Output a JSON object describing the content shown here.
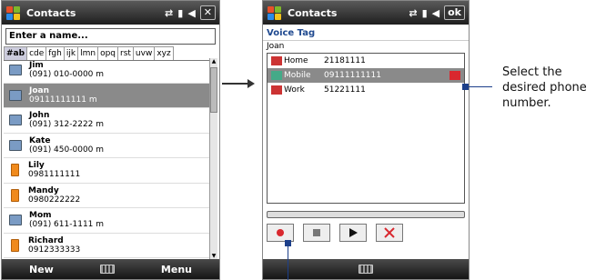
{
  "left": {
    "title": "Contacts",
    "close": "✕",
    "name_input": "Enter a name...",
    "tabs": [
      "#ab",
      "cde",
      "fgh",
      "ijk",
      "lmn",
      "opq",
      "rst",
      "uvw",
      "xyz"
    ],
    "contacts": [
      {
        "name": "Jim",
        "detail": "(091) 010-0000  m",
        "type": "card"
      },
      {
        "name": "Joan",
        "detail": "09111111111  m",
        "type": "card",
        "selected": true
      },
      {
        "name": "John",
        "detail": "(091) 312-2222  m",
        "type": "card"
      },
      {
        "name": "Kate",
        "detail": "(091) 450-0000  m",
        "type": "card"
      },
      {
        "name": "Lily",
        "detail": "0981111111",
        "type": "sim"
      },
      {
        "name": "Mandy",
        "detail": "0980222222",
        "type": "sim"
      },
      {
        "name": "Mom",
        "detail": "(091) 611-1111  m",
        "type": "card"
      },
      {
        "name": "Richard",
        "detail": "0912333333",
        "type": "sim"
      }
    ],
    "softkey_left": "New",
    "softkey_right": "Menu"
  },
  "right": {
    "title": "Contacts",
    "ok": "ok",
    "heading": "Voice Tag",
    "contact_name": "Joan",
    "numbers": [
      {
        "label": "Home",
        "number": "21181111"
      },
      {
        "label": "Mobile",
        "number": "09111111111",
        "selected": true
      },
      {
        "label": "Work",
        "number": "51221111"
      }
    ],
    "controls": [
      "record-icon",
      "stop-icon",
      "play-icon",
      "delete-icon"
    ]
  },
  "callout": {
    "text": "Select the desired phone number."
  },
  "colors": {
    "accent": "#1c3f8a",
    "record": "#d9282f"
  }
}
